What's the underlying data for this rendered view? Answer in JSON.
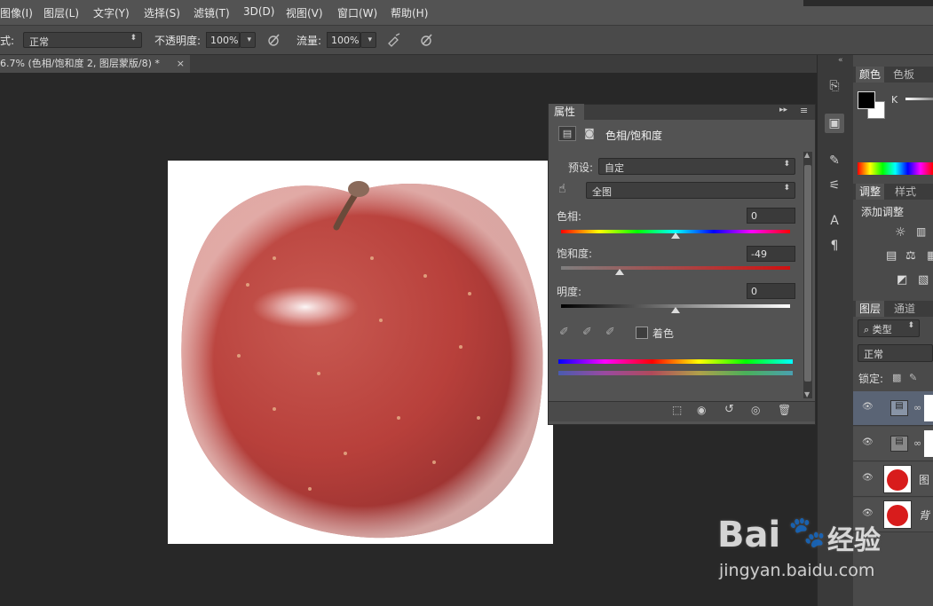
{
  "menu": [
    "图像(I)",
    "图层(L)",
    "文字(Y)",
    "选择(S)",
    "滤镜(T)",
    "3D(D)",
    "视图(V)",
    "窗口(W)",
    "帮助(H)"
  ],
  "options": {
    "mode_label": "式:",
    "mode_value": "正常",
    "opacity_label": "不透明度:",
    "opacity_value": "100%",
    "flow_label": "流量:",
    "flow_value": "100%"
  },
  "document": {
    "tab_title": "6.7% (色相/饱和度 2, 图层蒙版/8) *",
    "close": "×"
  },
  "properties": {
    "tab": "属性",
    "adjustment_name": "色相/饱和度",
    "preset_label": "预设:",
    "preset_value": "自定",
    "range_value": "全图",
    "hue_label": "色相:",
    "hue_value": "0",
    "hue_level": 0.5,
    "saturation_label": "饱和度:",
    "saturation_value": "-49",
    "saturation_level": 0.255,
    "lightness_label": "明度:",
    "lightness_value": "0",
    "lightness_level": 0.5,
    "colorize_label": "着色"
  },
  "right_panels": {
    "color_tab": "颜色",
    "swatches_tab": "色板",
    "k_label": "K",
    "adjust_tab": "调整",
    "styles_tab": "样式",
    "add_adjust": "添加调整",
    "layers_tab": "图层",
    "channels_tab": "通道",
    "filter_kind": "类型",
    "blend_mode": "正常",
    "lock_label": "锁定:",
    "layer_3_name": "图",
    "layer_4_name": "背"
  },
  "watermark": {
    "brand": "Bai",
    "brand_tail": "经验",
    "url": "jingyan.baidu.com"
  },
  "colors": {
    "apple_red": "#b53c37",
    "panel": "#535353",
    "canvas_bg": "#282828"
  }
}
